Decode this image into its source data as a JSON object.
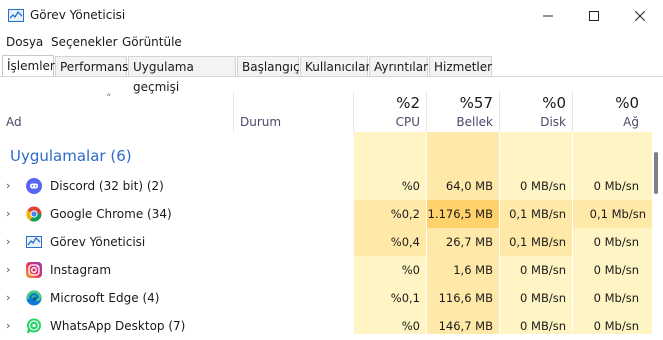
{
  "window": {
    "title": "Görev Yöneticisi"
  },
  "menu": [
    "Dosya",
    "Seçenekler",
    "Görüntüle"
  ],
  "tabs": [
    "İşlemler",
    "Performans",
    "Uygulama geçmişi",
    "Başlangıç",
    "Kullanıcılar",
    "Ayrıntılar",
    "Hizmetler"
  ],
  "columns": {
    "name": "Ad",
    "status": "Durum",
    "cpu": {
      "pct": "%2",
      "label": "CPU"
    },
    "memory": {
      "pct": "%57",
      "label": "Bellek"
    },
    "disk": {
      "pct": "%0",
      "label": "Disk"
    },
    "network": {
      "pct": "%0",
      "label": "Ağ"
    }
  },
  "group": {
    "title": "Uygulamalar (6)"
  },
  "rows": [
    {
      "name": "Discord (32 bit) (2)",
      "icon": "discord-icon",
      "cpu": "%0",
      "memory": "64,0 MB",
      "disk": "0 MB/sn",
      "network": "0 Mb/sn"
    },
    {
      "name": "Google Chrome (34)",
      "icon": "chrome-icon",
      "cpu": "%0,2",
      "memory": "1.176,5 MB",
      "disk": "0,1 MB/sn",
      "network": "0,1 Mb/sn"
    },
    {
      "name": "Görev Yöneticisi",
      "icon": "task-manager-icon",
      "cpu": "%0,4",
      "memory": "26,7 MB",
      "disk": "0,1 MB/sn",
      "network": "0 Mb/sn"
    },
    {
      "name": "Instagram",
      "icon": "instagram-icon",
      "cpu": "%0",
      "memory": "1,6 MB",
      "disk": "0 MB/sn",
      "network": "0 Mb/sn"
    },
    {
      "name": "Microsoft Edge (4)",
      "icon": "edge-icon",
      "cpu": "%0,1",
      "memory": "116,6 MB",
      "disk": "0 MB/sn",
      "network": "0 Mb/sn"
    },
    {
      "name": "WhatsApp Desktop (7)",
      "icon": "whatsapp-icon",
      "cpu": "%0",
      "memory": "146,7 MB",
      "disk": "0 MB/sn",
      "network": "0 Mb/sn"
    }
  ],
  "colors": {
    "heat_light": "#fff4c4",
    "heat_mid": "#ffe9a8",
    "heat_strong": "#ffd26b",
    "group_title": "#2b6cc4"
  }
}
